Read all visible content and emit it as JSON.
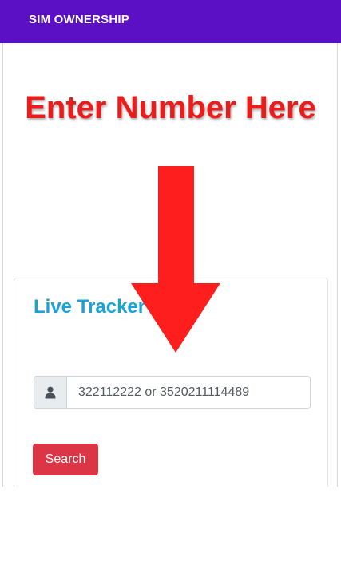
{
  "app_bar": {
    "title": "SIM OWNERSHIP",
    "color": "#5b10c5"
  },
  "overlay": {
    "headline": "Enter Number Here",
    "headline_color": "#ea1c1c",
    "arrow_color": "#ff1e1e"
  },
  "card": {
    "title": "Live Tracker",
    "title_color": "#1aa3d9",
    "input": {
      "value": "",
      "placeholder": "322112222 or 3520211114489",
      "icon": "user-icon"
    },
    "search_button_label": "Search",
    "search_button_color": "#dc3545"
  }
}
